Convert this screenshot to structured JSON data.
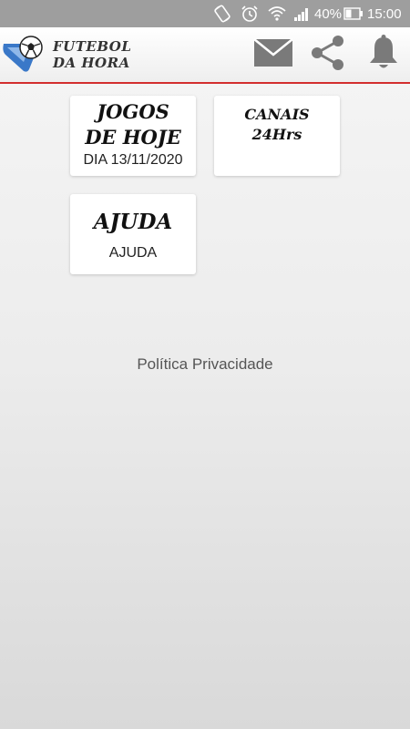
{
  "status_bar": {
    "battery_percent": "40%",
    "time": "15:00"
  },
  "app_bar": {
    "title_line1": "FUTEBOL",
    "title_line2": "DA HORA",
    "actions": [
      "mail-icon",
      "share-icon",
      "bell-icon"
    ]
  },
  "cards": {
    "games": {
      "title_line1": "JOGOS",
      "title_line2": "DE HOJE",
      "subtitle": "DIA 13/11/2020"
    },
    "channels": {
      "title_line1": "CANAIS",
      "title_line2": "24Hrs"
    },
    "help": {
      "title": "AJUDA",
      "subtitle": "AJUDA"
    }
  },
  "footer": {
    "privacy_link": "Política Privacidade"
  },
  "colors": {
    "accent_red": "#d32f2f",
    "status_bar": "#9e9e9e",
    "icon_gray": "#7a7a7a",
    "logo_blue": "#3a78c8"
  }
}
